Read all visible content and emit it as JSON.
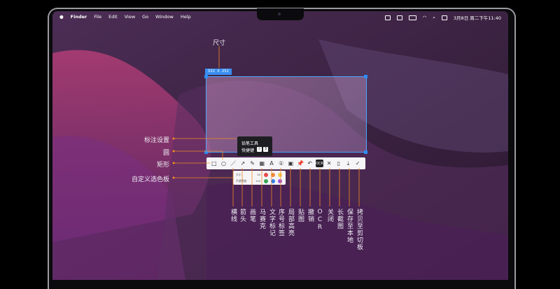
{
  "menubar": {
    "app": "Finder",
    "items": [
      "File",
      "Edit",
      "View",
      "Go",
      "Window",
      "Help"
    ],
    "clock": "3月8日 周二下午11:40"
  },
  "selection": {
    "size": "532 X 252"
  },
  "annotations": {
    "size": "尺寸",
    "annotate_settings": "标注设置",
    "circle": "圆",
    "rect": "矩形",
    "custom_color": "自定义选色板"
  },
  "tooltip": {
    "title": "铅笔工具",
    "shortcut_label": "快捷键",
    "key1": "⇧",
    "key2": "3"
  },
  "panel": {
    "size_label": "大小",
    "size_value": "16",
    "opacity_label": "不透明度",
    "opacity_value": "100"
  },
  "colors": [
    "#e84b4b",
    "#ef8a3a",
    "#f2c94c",
    "#3aa757",
    "#2f80ed",
    "#9b51e0"
  ],
  "tools": [
    {
      "label": "横线"
    },
    {
      "label": "箭头"
    },
    {
      "label": "画笔"
    },
    {
      "label": "马赛克"
    },
    {
      "label": "文字标记"
    },
    {
      "label": "序号标签"
    },
    {
      "label": "局部高亮"
    },
    {
      "label": "贴图"
    },
    {
      "label": "撤销"
    },
    {
      "label": "OCR"
    },
    {
      "label": "关闭"
    },
    {
      "label": "长截图"
    },
    {
      "label": "保存至本地"
    },
    {
      "label": "拷贝至剪切板"
    }
  ]
}
